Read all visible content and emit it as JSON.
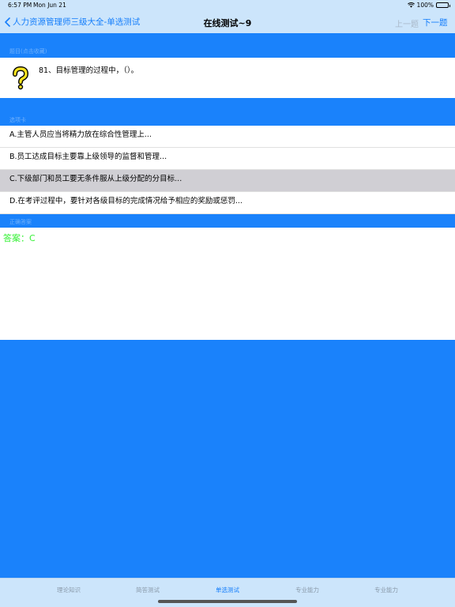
{
  "status": {
    "time": "6:57 PM",
    "date": "Mon Jun 21",
    "battery": "100%"
  },
  "nav": {
    "back_label": "人力资源管理师三级大全-单选测试",
    "title": "在线测试~9",
    "prev_label": "上一题",
    "next_label": "下一题"
  },
  "sections": {
    "question": "题目(点击收藏)",
    "options": "选项卡",
    "answer": "正确答案"
  },
  "question": {
    "icon": "question-mark-icon",
    "text": "81、目标管理的过程中，（）。"
  },
  "options": [
    {
      "label": "A.主管人员应当将精力放在综合性管理上...",
      "selected": false
    },
    {
      "label": "B.员工达成目标主要靠上级领导的监督和管理...",
      "selected": false
    },
    {
      "label": "C.下级部门和员工要无条件服从上级分配的分目标...",
      "selected": true
    },
    {
      "label": "D.在考评过程中，要针对各级目标的完成情况给予相应的奖励或惩罚...",
      "selected": false
    }
  ],
  "answer": {
    "text": "答案：C",
    "color": "#35f135"
  },
  "tabs": [
    {
      "label": "理论知识",
      "active": false
    },
    {
      "label": "简答测试",
      "active": false
    },
    {
      "label": "单选测试",
      "active": true
    },
    {
      "label": "专业能力",
      "active": false
    },
    {
      "label": "专业能力",
      "active": false
    }
  ],
  "colors": {
    "accent": "#157efb",
    "background": "#1a82fb",
    "bar": "#cce5fb",
    "selected": "#d0cfd4"
  }
}
